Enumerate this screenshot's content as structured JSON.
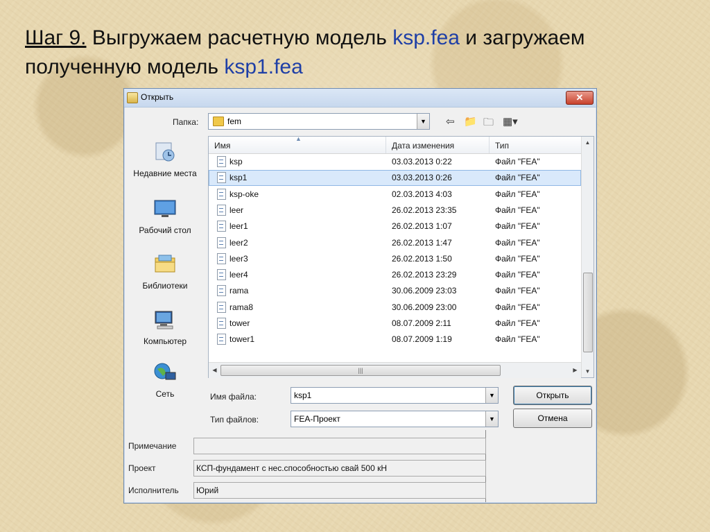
{
  "slide": {
    "step": "Шаг 9.",
    "line1_text": " Выгружаем расчетную модель ",
    "file1": "ksp.fea",
    "line1_tail": " и загружаем",
    "line2_text": "полученную модель ",
    "file2": "ksp1.fea"
  },
  "dialog": {
    "title": "Открыть",
    "close": "✕",
    "folder_label": "Папка:",
    "folder_value": "fem",
    "toolbar_icons": [
      "back-arrow-icon",
      "up-folder-icon",
      "new-folder-icon",
      "view-menu-icon"
    ]
  },
  "places": [
    {
      "label": "Недавние места",
      "icon": "recent-places-icon"
    },
    {
      "label": "Рабочий стол",
      "icon": "desktop-icon"
    },
    {
      "label": "Библиотеки",
      "icon": "libraries-icon"
    },
    {
      "label": "Компьютер",
      "icon": "computer-icon"
    },
    {
      "label": "Сеть",
      "icon": "network-icon"
    }
  ],
  "columns": {
    "name": "Имя",
    "date": "Дата изменения",
    "type": "Тип"
  },
  "files": [
    {
      "name": "ksp",
      "date": "03.03.2013 0:22",
      "type": "Файл \"FEA\""
    },
    {
      "name": "ksp1",
      "date": "03.03.2013 0:26",
      "type": "Файл \"FEA\""
    },
    {
      "name": "ksp-oke",
      "date": "02.03.2013 4:03",
      "type": "Файл \"FEA\""
    },
    {
      "name": "leer",
      "date": "26.02.2013 23:35",
      "type": "Файл \"FEA\""
    },
    {
      "name": "leer1",
      "date": "26.02.2013 1:07",
      "type": "Файл \"FEA\""
    },
    {
      "name": "leer2",
      "date": "26.02.2013 1:47",
      "type": "Файл \"FEA\""
    },
    {
      "name": "leer3",
      "date": "26.02.2013 1:50",
      "type": "Файл \"FEA\""
    },
    {
      "name": "leer4",
      "date": "26.02.2013 23:29",
      "type": "Файл \"FEA\""
    },
    {
      "name": "rama",
      "date": "30.06.2009 23:03",
      "type": "Файл \"FEA\""
    },
    {
      "name": "rama8",
      "date": "30.06.2009 23:00",
      "type": "Файл \"FEA\""
    },
    {
      "name": "tower",
      "date": "08.07.2009 2:11",
      "type": "Файл \"FEA\""
    },
    {
      "name": "tower1",
      "date": "08.07.2009 1:19",
      "type": "Файл \"FEA\""
    }
  ],
  "selected_file": "ksp1",
  "filename_label": "Имя файла:",
  "filename_value": "ksp1",
  "filetype_label": "Тип файлов:",
  "filetype_value": "FEA-Проект",
  "open_button": "Открыть",
  "cancel_button": "Отмена",
  "meta": {
    "note_label": "Примечание",
    "note_value": "",
    "project_label": "Проект",
    "project_value": "КСП-фундамент с нес.способностью свай 500 кН",
    "author_label": "Исполнитель",
    "author_value": "Юрий"
  }
}
